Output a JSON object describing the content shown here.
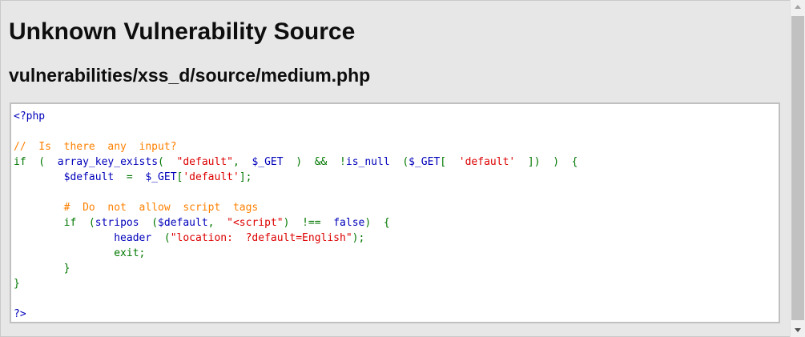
{
  "page": {
    "title": "Unknown Vulnerability Source",
    "subtitle": "vulnerabilities/xss_d/source/medium.php"
  },
  "colors": {
    "background": "#e7e7e7",
    "code_default": "#0000bb",
    "code_keyword": "#007700",
    "code_string": "#dd0000",
    "code_comment": "#ff8000"
  },
  "code": {
    "lines": [
      [
        {
          "t": "<?php",
          "c": "def"
        }
      ],
      [],
      [
        {
          "t": "//  Is  there  any  input?",
          "c": "com"
        }
      ],
      [
        {
          "t": "if  (  ",
          "c": "kw"
        },
        {
          "t": "array_key_exists",
          "c": "def"
        },
        {
          "t": "(  ",
          "c": "kw"
        },
        {
          "t": "\"default\"",
          "c": "str"
        },
        {
          "t": ",  ",
          "c": "kw"
        },
        {
          "t": "$_GET",
          "c": "def"
        },
        {
          "t": "  )  &&  !",
          "c": "kw"
        },
        {
          "t": "is_null",
          "c": "def"
        },
        {
          "t": "  (",
          "c": "kw"
        },
        {
          "t": "$_GET",
          "c": "def"
        },
        {
          "t": "[  ",
          "c": "kw"
        },
        {
          "t": "'default'",
          "c": "str"
        },
        {
          "t": "  ])  )  {",
          "c": "kw"
        }
      ],
      [
        {
          "t": "        ",
          "c": "def"
        },
        {
          "t": "$default",
          "c": "def"
        },
        {
          "t": "  =  ",
          "c": "kw"
        },
        {
          "t": "$_GET",
          "c": "def"
        },
        {
          "t": "[",
          "c": "kw"
        },
        {
          "t": "'default'",
          "c": "str"
        },
        {
          "t": "];",
          "c": "kw"
        }
      ],
      [],
      [
        {
          "t": "        ",
          "c": "def"
        },
        {
          "t": "#  Do  not  allow  script  tags",
          "c": "com"
        }
      ],
      [
        {
          "t": "        ",
          "c": "def"
        },
        {
          "t": "if  (",
          "c": "kw"
        },
        {
          "t": "stripos",
          "c": "def"
        },
        {
          "t": "  (",
          "c": "kw"
        },
        {
          "t": "$default",
          "c": "def"
        },
        {
          "t": ",  ",
          "c": "kw"
        },
        {
          "t": "\"<script\"",
          "c": "str"
        },
        {
          "t": ")  !==  ",
          "c": "kw"
        },
        {
          "t": "false",
          "c": "def"
        },
        {
          "t": ")  {",
          "c": "kw"
        }
      ],
      [
        {
          "t": "                ",
          "c": "def"
        },
        {
          "t": "header",
          "c": "def"
        },
        {
          "t": "  (",
          "c": "kw"
        },
        {
          "t": "\"location:  ?default=English\"",
          "c": "str"
        },
        {
          "t": ");",
          "c": "kw"
        }
      ],
      [
        {
          "t": "                ",
          "c": "def"
        },
        {
          "t": "exit;",
          "c": "kw"
        }
      ],
      [
        {
          "t": "        ",
          "c": "def"
        },
        {
          "t": "}",
          "c": "kw"
        }
      ],
      [
        {
          "t": "}",
          "c": "kw"
        }
      ],
      [],
      [
        {
          "t": "?>",
          "c": "def"
        }
      ]
    ]
  },
  "scrollbar": {
    "up_icon": "triangle-up",
    "down_icon": "triangle-down"
  }
}
